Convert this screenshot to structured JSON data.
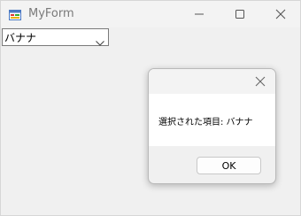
{
  "window": {
    "title": "MyForm",
    "icon": "app-form-icon",
    "controls": [
      "minimize-icon",
      "maximize-icon",
      "close-icon"
    ]
  },
  "combo": {
    "selected": "バナナ",
    "icon": "chevron-down-icon"
  },
  "dialog": {
    "message": "選択された項目: バナナ",
    "ok_label": "OK",
    "close_icon": "close-icon"
  },
  "colors": {
    "window_bg": "#f0f0f0",
    "titlebar_bg": "#f3f3f3",
    "dialog_body_bg": "#ffffff",
    "button_border": "#c8c8c8",
    "title_text": "#7a7a7a"
  }
}
